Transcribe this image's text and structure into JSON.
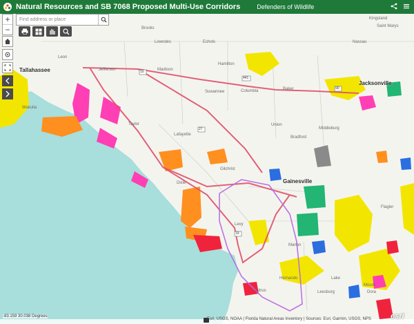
{
  "header": {
    "title": "Natural Resources and SB 7068 Proposed Multi-Use Corridors",
    "subtitle": "Defenders of Wildlife"
  },
  "search": {
    "placeholder": "Find address or place"
  },
  "toolbar": {
    "icons": [
      "print-icon",
      "basemap-icon",
      "legend-icon",
      "zoom-search-icon"
    ]
  },
  "zoom": {
    "in": "+",
    "out": "−"
  },
  "status": {
    "coordinates": "-83.159 30.038 Degrees"
  },
  "attribution": {
    "text": "Esri, USGS, NOAA | Florida Natural Areas Inventory | Sources: Esri, Garmin, USGS, NPS",
    "logo": "esri"
  },
  "map": {
    "places": [
      {
        "name": "Brooks",
        "l": 205,
        "t": 18
      },
      {
        "name": "Lowndes",
        "l": 224,
        "t": 38
      },
      {
        "name": "Echols",
        "l": 294,
        "t": 38
      },
      {
        "name": "Kingsland",
        "l": 535,
        "t": 24
      },
      {
        "name": "Saint Marys",
        "l": 546,
        "t": 35
      },
      {
        "name": "Nassau",
        "l": 511,
        "t": 58
      },
      {
        "name": "Leon",
        "l": 84,
        "t": 80
      },
      {
        "name": "Hamilton",
        "l": 316,
        "t": 90
      },
      {
        "name": "Madison",
        "l": 228,
        "t": 98
      },
      {
        "name": "Jefferson",
        "l": 143,
        "t": 98
      },
      {
        "name": "Suwannee",
        "l": 297,
        "t": 130
      },
      {
        "name": "Columbia",
        "l": 349,
        "t": 129
      },
      {
        "name": "Baker",
        "l": 410,
        "t": 126
      },
      {
        "name": "Wakulla",
        "l": 32,
        "t": 153
      },
      {
        "name": "Taylor",
        "l": 186,
        "t": 177
      },
      {
        "name": "Union",
        "l": 393,
        "t": 178
      },
      {
        "name": "Lafayette",
        "l": 252,
        "t": 192
      },
      {
        "name": "Bradford",
        "l": 421,
        "t": 196
      },
      {
        "name": "Gilchrist",
        "l": 319,
        "t": 242
      },
      {
        "name": "Dixie",
        "l": 256,
        "t": 262
      },
      {
        "name": "Levy",
        "l": 340,
        "t": 322
      },
      {
        "name": "Marion",
        "l": 418,
        "t": 352
      },
      {
        "name": "Citrus",
        "l": 370,
        "t": 418
      },
      {
        "name": "Hernando",
        "l": 405,
        "t": 400
      },
      {
        "name": "Flagler",
        "l": 552,
        "t": 297
      },
      {
        "name": "Lake",
        "l": 480,
        "t": 400
      },
      {
        "name": "Mount",
        "l": 527,
        "t": 410
      },
      {
        "name": "Dora",
        "l": 532,
        "t": 420
      },
      {
        "name": "Leesburg",
        "l": 460,
        "t": 420
      },
      {
        "name": "Middleburg",
        "l": 462,
        "t": 183
      }
    ],
    "cities": [
      {
        "name": "Tallahassee",
        "l": 28,
        "t": 97
      },
      {
        "name": "Jacksonville",
        "l": 520,
        "t": 116
      },
      {
        "name": "Gainesville",
        "l": 410,
        "t": 258
      }
    ],
    "routes": [
      "10",
      "27",
      "441",
      "19",
      "90"
    ]
  },
  "colors": {
    "sea": "#a8dedb",
    "land": "#f4f4ef",
    "corridor_red": "#e0506a",
    "corridor_purple": "#b76ce0",
    "yellow": "#f2e600",
    "pink": "#ff3fb4",
    "orange": "#ff8f1f",
    "red": "#f0233d",
    "blue": "#2b6ee0"
  }
}
